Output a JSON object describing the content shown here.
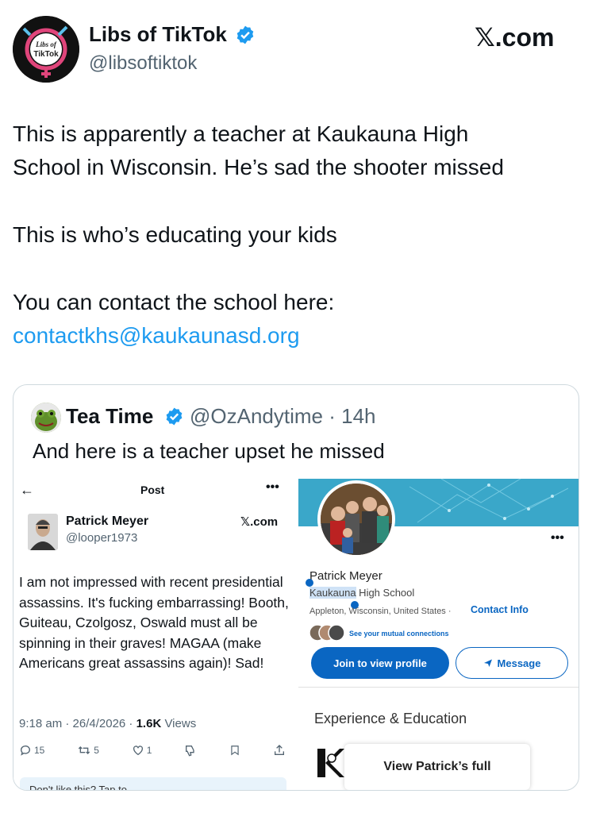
{
  "author": {
    "name": "Libs of TikTok",
    "handle": "@libsoftiktok",
    "avatar_text": [
      "Libs of",
      "TikTok"
    ]
  },
  "watermark": "𝕏.com",
  "tweet_lines": [
    "This is apparently a teacher at Kaukauna High",
    "School in Wisconsin. He’s sad the shooter missed",
    "This is who’s educating your kids",
    "You can contact the school here:",
    "contactkhs@kaukaunasd.org"
  ],
  "quote": {
    "name": "Tea Time",
    "handle": "@OzAndytime · 14h",
    "text": "And here is a teacher upset he missed"
  },
  "embedded_x": {
    "header_title": "Post",
    "back_icon": "←",
    "more": "•••",
    "name": "Patrick Meyer",
    "handle": "@looper1973",
    "watermark": "𝕏.com",
    "text": "I am not impressed with recent presidential assassins.  It's fucking embarrassing!  Booth, Guiteau, Czolgosz, Oswald must all be spinning in their graves!  MAGAA (make Americans great assassins again)!  Sad!",
    "meta_time": "9:18 am · 26/4/2026 · ",
    "meta_views": "1.6K",
    "meta_views_label": " Views",
    "replies": "15",
    "reposts": "5",
    "likes": "1",
    "banner": "Don't like this? Tap to"
  },
  "linkedin": {
    "name": "Patrick Meyer",
    "school_hl": "Kaukauna",
    "school_rest": " High School",
    "location": "Appleton, Wisconsin, United States ·",
    "contact": "Contact Info",
    "mutual": "See your mutual connections",
    "join": "Join to view profile",
    "message": "Message",
    "experience": "Experience & Education",
    "view": "View Patrick’s full",
    "more": "•••"
  },
  "colors": {
    "link": "#1d9bf0",
    "verified": "#1d9bf0",
    "linkedin": "#0a66c2"
  }
}
